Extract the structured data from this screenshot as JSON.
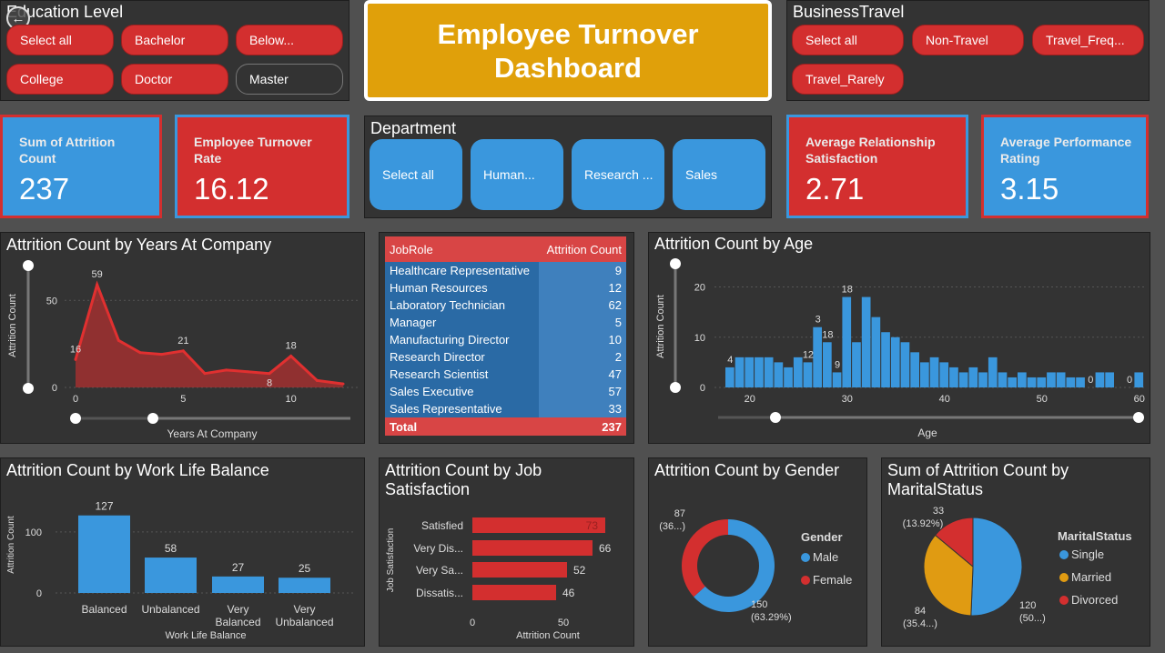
{
  "education": {
    "title": "Education Level",
    "options": [
      {
        "label": "Select all",
        "selected": true
      },
      {
        "label": "Bachelor",
        "selected": true
      },
      {
        "label": "Below...",
        "selected": true
      },
      {
        "label": "College",
        "selected": true
      },
      {
        "label": "Doctor",
        "selected": true
      },
      {
        "label": "Master",
        "selected": false
      }
    ]
  },
  "dashboard_title": "Employee Turnover Dashboard",
  "travel": {
    "title": "BusinessTravel",
    "options": [
      {
        "label": "Select all"
      },
      {
        "label": "Non-Travel"
      },
      {
        "label": "Travel_Freq..."
      },
      {
        "label": "Travel_Rarely"
      }
    ]
  },
  "kpis": {
    "attrition": {
      "label": "Sum of Attrition Count",
      "value": "237"
    },
    "turnover": {
      "label": "Employee Turnover Rate",
      "value": "16.12"
    },
    "relationship": {
      "label": "Average Relationship Satisfaction",
      "value": "2.71"
    },
    "performance": {
      "label": "Average Performance Rating",
      "value": "3.15"
    }
  },
  "department": {
    "title": "Department",
    "options": [
      "Select all",
      "Human...",
      "Research ...",
      "Sales"
    ]
  },
  "table": {
    "headers": [
      "JobRole",
      "Attrition Count"
    ],
    "rows": [
      {
        "role": "Healthcare Representative",
        "count": "9"
      },
      {
        "role": "Human Resources",
        "count": "12"
      },
      {
        "role": "Laboratory Technician",
        "count": "62"
      },
      {
        "role": "Manager",
        "count": "5"
      },
      {
        "role": "Manufacturing Director",
        "count": "10"
      },
      {
        "role": "Research Director",
        "count": "2"
      },
      {
        "role": "Research Scientist",
        "count": "47"
      },
      {
        "role": "Sales Executive",
        "count": "57"
      },
      {
        "role": "Sales Representative",
        "count": "33"
      }
    ],
    "total_label": "Total",
    "total_value": "237"
  },
  "colors": {
    "red": "#d32f2f",
    "blue": "#3a97dd",
    "gold": "#e0a00a",
    "dark": "#333333",
    "orange": "#e09b12"
  },
  "chart_data": [
    {
      "id": "years",
      "type": "area",
      "title": "Attrition Count by Years At Company",
      "xlabel": "Years At Company",
      "ylabel": "Attrition Count",
      "x": [
        0,
        1,
        2,
        3,
        4,
        5,
        6,
        7,
        8,
        9,
        10,
        11,
        12
      ],
      "values": [
        16,
        59,
        27,
        20,
        19,
        21,
        8,
        10,
        9,
        8,
        18,
        4,
        2
      ],
      "data_labels": [
        {
          "x": 0,
          "text": "16"
        },
        {
          "x": 1,
          "text": "59"
        },
        {
          "x": 5,
          "text": "21"
        },
        {
          "x": 9,
          "text": "8"
        },
        {
          "x": 10,
          "text": "18"
        }
      ],
      "xticks": [
        "0",
        "5",
        "10"
      ],
      "yticks": [
        "0",
        "50"
      ],
      "ylim": [
        0,
        70
      ]
    },
    {
      "id": "age",
      "type": "bar",
      "title": "Attrition Count by Age",
      "xlabel": "Age",
      "ylabel": "Attrition Count",
      "x": [
        18,
        19,
        20,
        21,
        22,
        23,
        24,
        25,
        26,
        27,
        28,
        29,
        30,
        31,
        32,
        33,
        34,
        35,
        36,
        37,
        38,
        39,
        40,
        41,
        42,
        43,
        44,
        45,
        46,
        47,
        48,
        49,
        50,
        51,
        52,
        53,
        54,
        55,
        56,
        57,
        58,
        59,
        60
      ],
      "values": [
        4,
        6,
        6,
        6,
        6,
        5,
        4,
        6,
        5,
        12,
        9,
        3,
        18,
        9,
        18,
        14,
        11,
        10,
        9,
        7,
        5,
        6,
        5,
        4,
        3,
        4,
        3,
        6,
        3,
        2,
        3,
        2,
        2,
        3,
        3,
        2,
        2,
        0,
        3,
        3,
        0,
        0,
        3
      ],
      "data_labels": [
        {
          "x": 18,
          "text": "4"
        },
        {
          "x": 26,
          "text": "12"
        },
        {
          "x": 27,
          "text": "3"
        },
        {
          "x": 28,
          "text": "18"
        },
        {
          "x": 29,
          "text": "9"
        },
        {
          "x": 30,
          "text": "18"
        },
        {
          "x": 55,
          "text": "0"
        },
        {
          "x": 59,
          "text": "0"
        }
      ],
      "xticks": [
        "20",
        "30",
        "40",
        "50",
        "60"
      ],
      "yticks": [
        "0",
        "10",
        "20"
      ],
      "ylim": [
        0,
        21
      ]
    },
    {
      "id": "wlb",
      "type": "bar",
      "title": "Attrition Count by Work Life Balance",
      "xlabel": "Work Life Balance",
      "ylabel": "Attrition Count",
      "categories": [
        "Balanced",
        "Unbalanced",
        "Very Balanced",
        "Very Unbalanced"
      ],
      "values": [
        127,
        58,
        27,
        25
      ],
      "yticks": [
        "0",
        "100"
      ],
      "ylim": [
        0,
        140
      ]
    },
    {
      "id": "jobsat",
      "type": "bar",
      "title": "Attrition Count by Job Satisfaction",
      "xlabel": "Attrition Count",
      "ylabel": "Job Satisfaction",
      "categories": [
        "Satisfied",
        "Very Dis...",
        "Very Sa...",
        "Dissatis..."
      ],
      "values": [
        73,
        66,
        52,
        46
      ],
      "xticks": [
        "0",
        "50"
      ],
      "xlim": [
        0,
        80
      ]
    },
    {
      "id": "gender",
      "type": "pie",
      "title": "Attrition Count by Gender",
      "legend_title": "Gender",
      "labels": [
        "Male",
        "Female"
      ],
      "values": [
        150,
        87
      ],
      "slice_labels": [
        [
          "150",
          "(63.29%)"
        ],
        [
          "87",
          "(36...)"
        ]
      ]
    },
    {
      "id": "marital",
      "type": "pie",
      "title": "Sum of Attrition Count by MaritalStatus",
      "legend_title": "MaritalStatus",
      "labels": [
        "Single",
        "Married",
        "Divorced"
      ],
      "values": [
        120,
        84,
        33
      ],
      "slice_labels": [
        [
          "120",
          "(50...)"
        ],
        [
          "84",
          "(35.4...)"
        ],
        [
          "33",
          "(13.92%)"
        ]
      ]
    }
  ]
}
